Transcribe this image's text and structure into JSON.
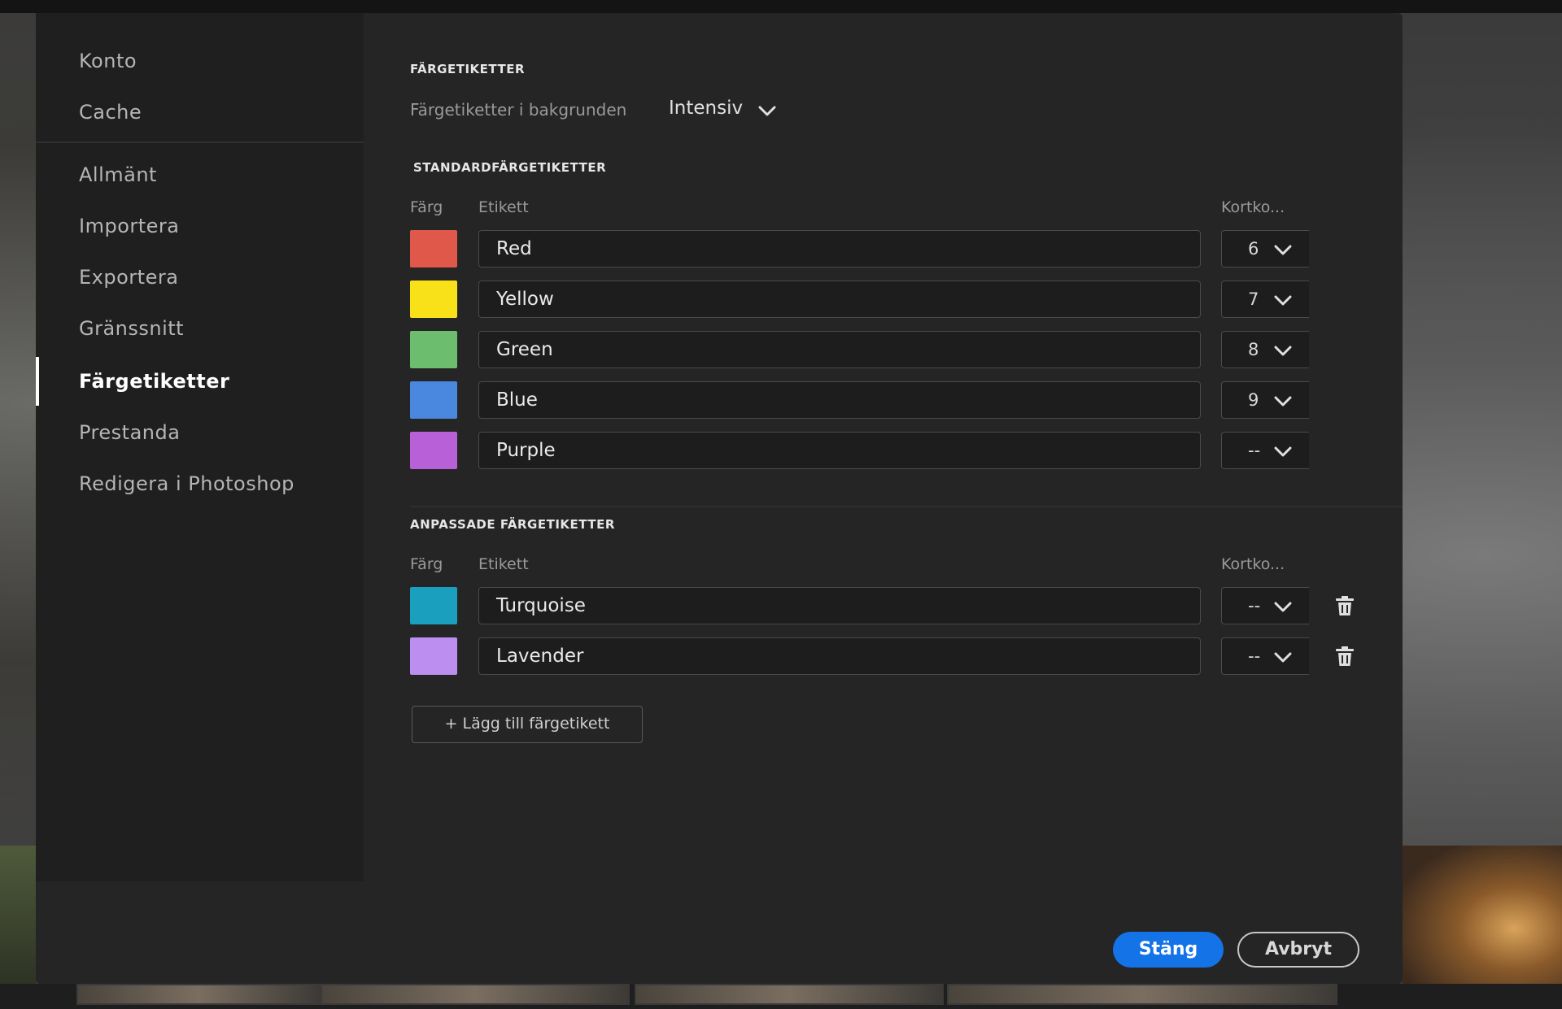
{
  "sidebar": {
    "items": [
      {
        "label": "Konto"
      },
      {
        "label": "Cache"
      },
      {
        "label": "Allmänt"
      },
      {
        "label": "Importera"
      },
      {
        "label": "Exportera"
      },
      {
        "label": "Gränssnitt"
      },
      {
        "label": "Färgetiketter"
      },
      {
        "label": "Prestanda"
      },
      {
        "label": "Redigera i Photoshop"
      }
    ],
    "active": "Färgetiketter"
  },
  "main": {
    "section1_title": "FÄRGETIKETTER",
    "background_label": "Färgetiketter i bakgrunden",
    "background_value": "Intensiv",
    "standard_title": "STANDARDFÄRGETIKETTER",
    "custom_title": "ANPASSADE FÄRGETIKETTER",
    "col_color": "Färg",
    "col_label": "Etikett",
    "col_shortcut": "Kortko...",
    "standard_labels": [
      {
        "color": "#e0584a",
        "label": "Red",
        "shortcut": "6"
      },
      {
        "color": "#f9e11a",
        "label": "Yellow",
        "shortcut": "7"
      },
      {
        "color": "#6cbd6e",
        "label": "Green",
        "shortcut": "8"
      },
      {
        "color": "#4a88e0",
        "label": "Blue",
        "shortcut": "9"
      },
      {
        "color": "#b860d8",
        "label": "Purple",
        "shortcut": "--"
      }
    ],
    "custom_labels": [
      {
        "color": "#1a9fbe",
        "label": "Turquoise",
        "shortcut": "--"
      },
      {
        "color": "#bc8ef0",
        "label": "Lavender",
        "shortcut": "--"
      }
    ],
    "add_button": "+ Lägg till färgetikett"
  },
  "footer": {
    "close_button": "Stäng",
    "cancel_button": "Avbryt"
  },
  "icons": {
    "dropdown": "chevron-down-icon",
    "delete": "trash-icon"
  },
  "colors": {
    "accent": "#1473e6"
  }
}
